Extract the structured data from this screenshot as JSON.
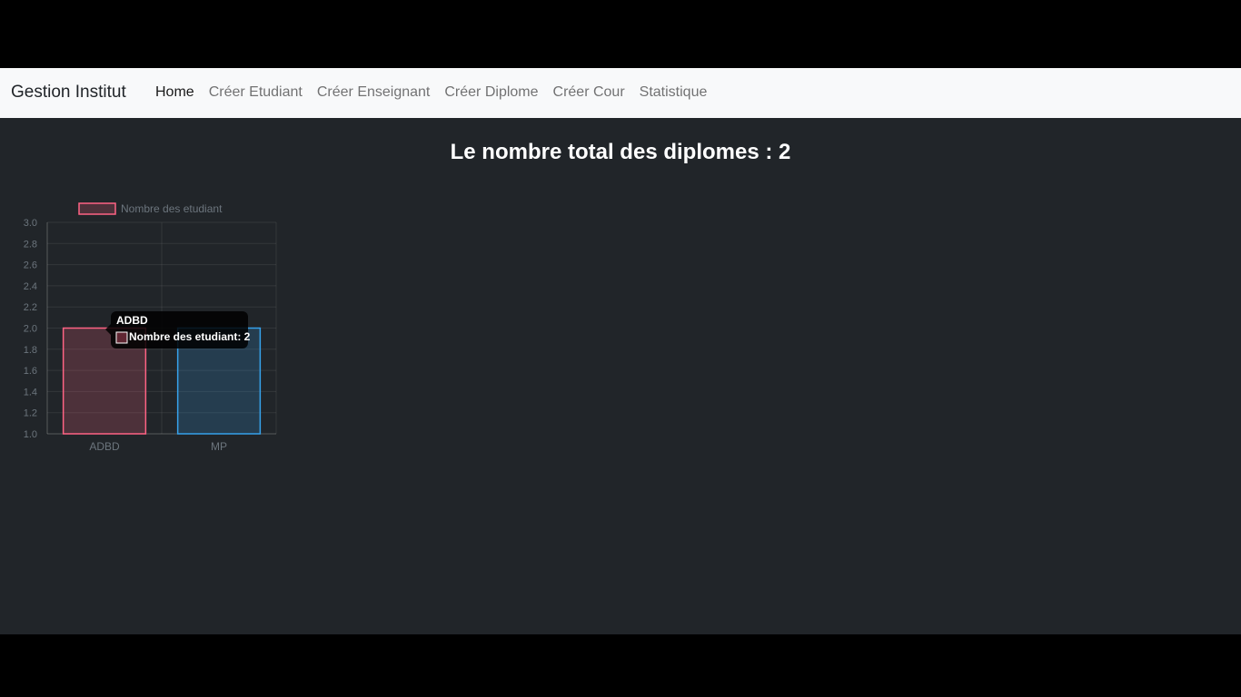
{
  "navbar": {
    "brand": "Gestion Institut",
    "links": [
      {
        "label": "Home",
        "active": true
      },
      {
        "label": "Créer Etudiant",
        "active": false
      },
      {
        "label": "Créer Enseignant",
        "active": false
      },
      {
        "label": "Créer Diplome",
        "active": false
      },
      {
        "label": "Créer Cour",
        "active": false
      },
      {
        "label": "Statistique",
        "active": false
      }
    ]
  },
  "main": {
    "heading": "Le nombre total des diplomes : 2"
  },
  "chart_data": {
    "type": "bar",
    "categories": [
      "ADBD",
      "MP"
    ],
    "series": [
      {
        "name": "Nombre des etudiant",
        "values": [
          2,
          2
        ]
      }
    ],
    "bar_colors": [
      "#ff6384",
      "#36a2eb"
    ],
    "ylim": [
      1.0,
      3.0
    ],
    "yticks": [
      "1.0",
      "1.2",
      "1.4",
      "1.6",
      "1.8",
      "2.0",
      "2.2",
      "2.4",
      "2.6",
      "2.8",
      "3.0"
    ],
    "grid": true,
    "legend_position": "top",
    "tooltip": {
      "title": "ADBD",
      "label": "Nombre des etudiant: 2"
    }
  }
}
